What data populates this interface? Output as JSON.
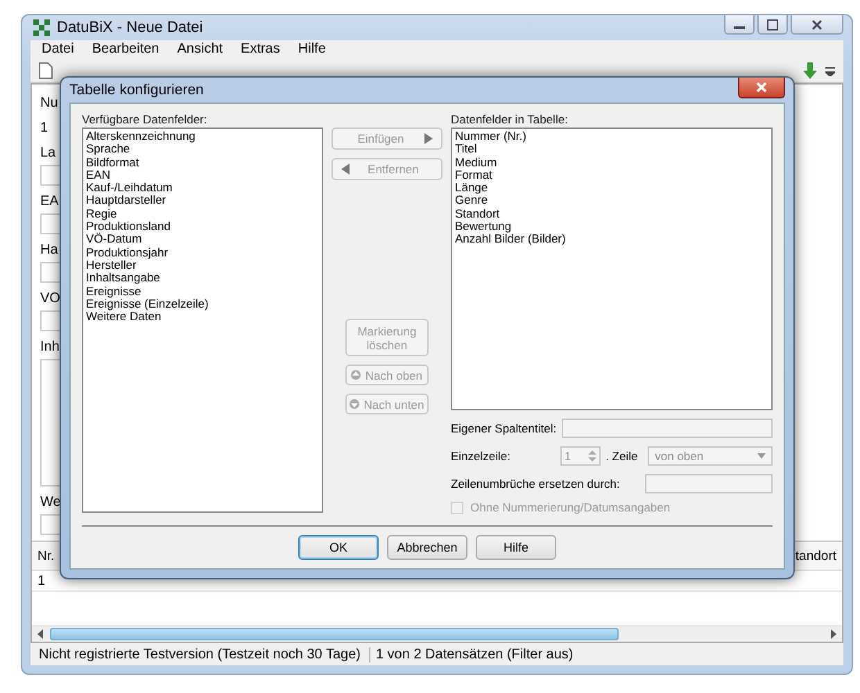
{
  "window": {
    "title": "DatuBiX - Neue Datei"
  },
  "menu": [
    "Datei",
    "Bearbeiten",
    "Ansicht",
    "Extras",
    "Hilfe"
  ],
  "form_labels": [
    "Nu",
    "1",
    "La",
    "EA",
    "Ha",
    "VO",
    "Inh",
    "We"
  ],
  "grid": {
    "columns": [
      "Nr.",
      "tandort"
    ],
    "rows": [
      [
        "1"
      ]
    ]
  },
  "status_bar": [
    "Nicht registrierte Testversion (Testzeit noch 30 Tage)",
    "1 von 2 Datensätzen (Filter aus)"
  ],
  "dialog": {
    "title": "Tabelle konfigurieren",
    "available_label": "Verfügbare Datenfelder:",
    "available": [
      "Alterskennzeichnung",
      "Sprache",
      "Bildformat",
      "EAN",
      "Kauf-/Leihdatum",
      "Hauptdarsteller",
      "Regie",
      "Produktionsland",
      "VÖ-Datum",
      "Produktionsjahr",
      "Hersteller",
      "Inhaltsangabe",
      "Ereignisse",
      "Ereignisse (Einzelzeile)",
      "Weitere Daten"
    ],
    "table_label": "Datenfelder in Tabelle:",
    "table_fields": [
      "Nummer (Nr.)",
      "Titel",
      "Medium",
      "Format",
      "Länge",
      "Genre",
      "Standort",
      "Bewertung",
      "Anzahl Bilder (Bilder)"
    ],
    "move_buttons": [
      {
        "label": "Einfügen",
        "kind": "right",
        "disabled": true
      },
      {
        "label": "Entfernen",
        "kind": "left",
        "disabled": true
      }
    ],
    "order_buttons": [
      {
        "label": "Markierung löschen",
        "kind": "plain",
        "disabled": true
      },
      {
        "label": "Nach oben",
        "kind": "up",
        "disabled": true
      },
      {
        "label": "Nach unten",
        "kind": "down",
        "disabled": true
      }
    ],
    "column_title_label": "Eigener Spaltentitel:",
    "single_line_label": "Einzelzeile:",
    "single_line_value": "1",
    "line_label": ". Zeile",
    "line_select": "von oben",
    "linebreak_label": "Zeilenumbrüche ersetzen durch:",
    "no_numbering": {
      "label": "Ohne Nummerierung/Datumsangaben",
      "checked": false,
      "disabled": true
    },
    "buttons": [
      {
        "label": "OK",
        "default": true
      },
      {
        "label": "Abbrechen",
        "default": false
      },
      {
        "label": "Hilfe",
        "default": false
      }
    ]
  }
}
